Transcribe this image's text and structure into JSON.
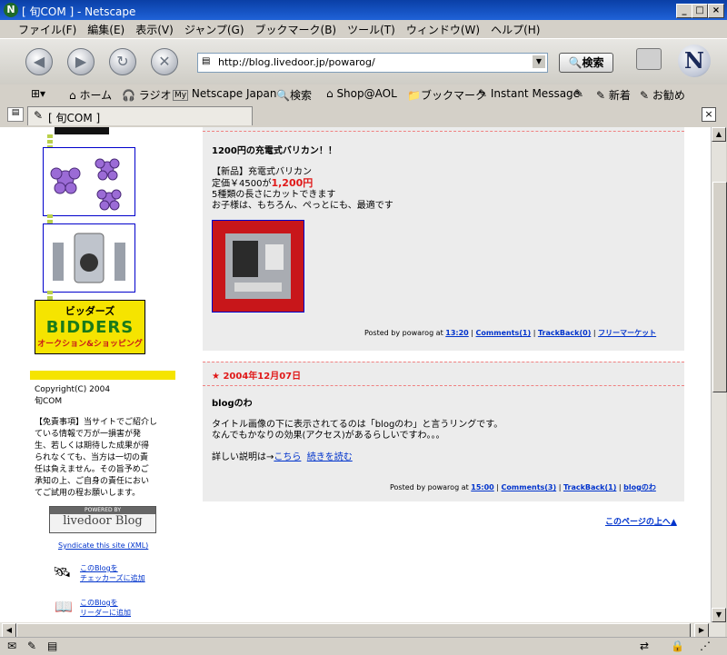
{
  "window": {
    "title": "[ 旬COM ] - Netscape",
    "app_icon": "N"
  },
  "menu": [
    "ファイル(F)",
    "編集(E)",
    "表示(V)",
    "ジャンプ(G)",
    "ブックマーク(B)",
    "ツール(T)",
    "ウィンドウ(W)",
    "ヘルプ(H)"
  ],
  "nav": {
    "url": "http://blog.livedoor.jp/powarog/",
    "search_label": "検索"
  },
  "personal_bar": {
    "items": [
      "ホーム",
      "ラジオ",
      "Netscape Japan",
      "検索",
      "Shop@AOL",
      "ブックマーク",
      "Instant Message",
      "新着",
      "お勧め"
    ],
    "my_badge": "My"
  },
  "tab": {
    "label": "[ 旬COM ]"
  },
  "sidebar": {
    "bidders": {
      "kana": "ビッダーズ",
      "logo": "BIDDERS",
      "sub": "オークション&ショッピング"
    },
    "copyright": [
      "Copyright(C) 2004",
      "旬COM"
    ],
    "disclaimer": [
      "【免責事項】当サイトでご紹介し",
      "ている情報で万が一損害が発",
      "生、若しくは期待した成果が得",
      "られなくても、当方は一切の責",
      "任は負えません。その旨予めご",
      "承知の上、ご自身の責任におい",
      "てご試用の程お願いします。"
    ],
    "powered": {
      "top": "POWERED BY",
      "brand": "livedoor Blog"
    },
    "syndicate": "Syndicate this site (XML)",
    "checkers": [
      "このBlogを",
      "チェッカーズに追加"
    ],
    "reader": [
      "このBlogを",
      "リーダーに追加"
    ]
  },
  "posts": [
    {
      "title": "1200円の充電式バリカン！！",
      "body": [
        "【新品】充電式バリカン",
        "5種類の長さにカットできます",
        "お子様は、もちろん、ぺっとにも、最適です"
      ],
      "price_prefix": "定価￥4500が",
      "price_sale": "1,200円",
      "footer": {
        "posted": "Posted by powarog at",
        "time": "13:20",
        "comments": "Comments(1)",
        "trackback": "TrackBack(0)",
        "category": "フリーマーケット"
      }
    },
    {
      "date": "2004年12月07日",
      "title": "blogのわ",
      "body": [
        "タイトル画像の下に表示されてるのは「blogのわ」と言うリングです。",
        "なんでもかなりの効果(アクセス)があるらしいですわ。。。"
      ],
      "detail_prefix": "詳しい説明は→",
      "detail_link": "こちら",
      "more_link": "続きを読む",
      "footer": {
        "posted": "Posted by powarog at",
        "time": "15:00",
        "comments": "Comments(3)",
        "trackback": "TrackBack(1)",
        "category": "blogのわ"
      }
    }
  ],
  "page_top": "このページの上へ▲",
  "colors": {
    "accent_red": "#e01818",
    "link": "#0033cc",
    "post_bg": "#ececec",
    "sidebar_yellow": "#f5e400"
  }
}
